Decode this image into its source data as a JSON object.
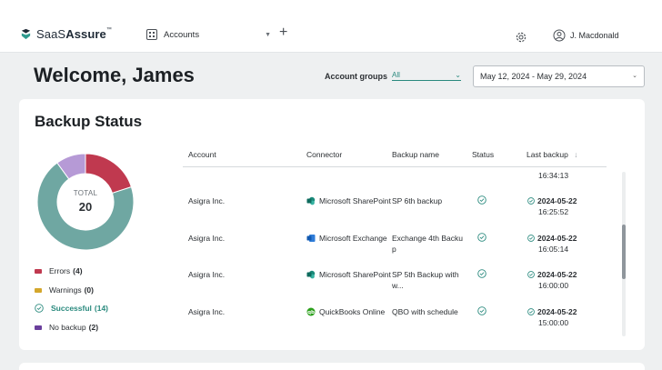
{
  "header": {
    "brand_prefix": "SaaS",
    "brand_suffix": "Assure",
    "brand_tm": "™",
    "account_switch_label": "Accounts",
    "user_name": "J. Macdonald"
  },
  "welcome": "Welcome, James",
  "filters": {
    "account_groups_label": "Account groups",
    "account_groups_value": "All",
    "date_range": "May 12, 2024 - May 29, 2024"
  },
  "backup_status": {
    "title": "Backup Status",
    "total_label": "TOTAL",
    "total_value": "20",
    "legend": [
      {
        "label": "Errors",
        "count": "(4)",
        "color": "#c0394f",
        "value": 4
      },
      {
        "label": "Warnings",
        "count": "(0)",
        "color": "#d4a72c",
        "value": 0
      },
      {
        "label": "Successful",
        "count": "(14)",
        "color": "#6fa7a2",
        "value": 14
      },
      {
        "label": "No backup",
        "count": "(2)",
        "color": "#b69ad6",
        "value": 2
      }
    ],
    "columns": [
      "Account",
      "Connector",
      "Backup name",
      "Status",
      "Last backup"
    ],
    "partial_row_time": "16:34:13",
    "rows": [
      {
        "account": "Asigra Inc.",
        "connector": "Microsoft SharePoint",
        "connector_icon": "sharepoint-icon",
        "backup_name_1": "SP 6th backup",
        "backup_name_2": "",
        "date": "2024-05-22",
        "time": "16:25:52"
      },
      {
        "account": "Asigra Inc.",
        "connector": "Microsoft Exchange",
        "connector_icon": "exchange-icon",
        "backup_name_1": "Exchange 4th Backu",
        "backup_name_2": "p",
        "date": "2024-05-22",
        "time": "16:05:14"
      },
      {
        "account": "Asigra Inc.",
        "connector": "Microsoft SharePoint",
        "connector_icon": "sharepoint-icon",
        "backup_name_1": "SP 5th Backup with",
        "backup_name_2": "w...",
        "date": "2024-05-22",
        "time": "16:00:00"
      },
      {
        "account": "Asigra Inc.",
        "connector": "QuickBooks Online",
        "connector_icon": "quickbooks-icon",
        "backup_name_1": "QBO with schedule",
        "backup_name_2": "",
        "date": "2024-05-22",
        "time": "15:00:00"
      }
    ]
  },
  "colors": {
    "accent": "#2a8a7e",
    "error": "#c0394f",
    "success": "#6fa7a2",
    "no_backup": "#b69ad6"
  }
}
